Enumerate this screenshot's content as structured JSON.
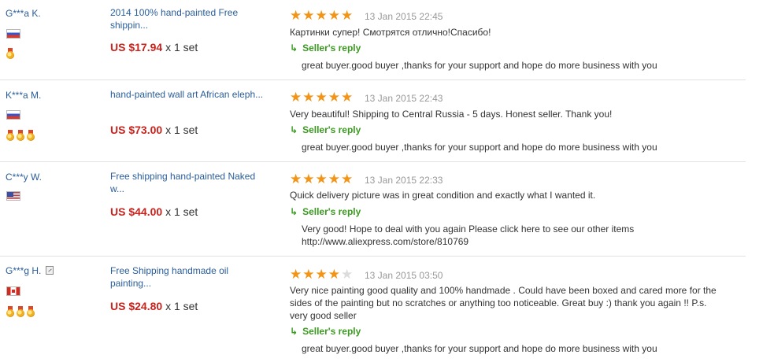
{
  "reviews": [
    {
      "buyer": "G***a K.",
      "flag": "russia-flag",
      "medals": 1,
      "mobile": false,
      "product": "2014 100% hand-painted Free shippin...",
      "price": "US $17.94",
      "qty": "x 1 set",
      "rating": 5,
      "date": "13 Jan 2015 22:45",
      "feedback": "Картинки супер! Смотрятся отлично!Спасибо!",
      "reply_label": "Seller's reply",
      "reply": "great buyer.good buyer ,thanks for your support and hope do more business with you"
    },
    {
      "buyer": "K***a M.",
      "flag": "russia-flag",
      "medals": 3,
      "mobile": false,
      "product": "hand-painted wall art African eleph...",
      "price": "US $73.00",
      "qty": "x 1 set",
      "rating": 5,
      "date": "13 Jan 2015 22:43",
      "feedback": "Very beautiful! Shipping to Central Russia - 5 days. Honest seller. Thank you!",
      "reply_label": "Seller's reply",
      "reply": "great buyer.good buyer ,thanks for your support and hope do more business with you"
    },
    {
      "buyer": "C***y W.",
      "flag": "usa-flag",
      "medals": 0,
      "mobile": false,
      "product": "Free shipping hand-painted Naked w...",
      "price": "US $44.00",
      "qty": "x 1 set",
      "rating": 5,
      "date": "13 Jan 2015 22:33",
      "feedback": "Quick delivery picture was in great condition and exactly what I wanted it.",
      "reply_label": "Seller's reply",
      "reply": "Very good! Hope to deal with you again Please click here to see our other items",
      "reply_url": "http://www.aliexpress.com/store/810769"
    },
    {
      "buyer": "G***g H.",
      "flag": "canada-flag",
      "medals": 3,
      "mobile": true,
      "product": "Free Shipping handmade oil painting...",
      "price": "US $24.80",
      "qty": "x 1 set",
      "rating": 4,
      "date": "13 Jan 2015 03:50",
      "feedback": "Very nice painting good quality and 100% handmade . Could have been boxed and cared more for the sides of the painting but no scratches or anything too noticeable. Great buy :) thank you again !! P.s. very good seller",
      "reply_label": "Seller's reply",
      "reply": "great buyer.good buyer ,thanks for your support and hope do more business with you"
    }
  ],
  "colors": {
    "link": "#2a5d99",
    "price": "#c8231d",
    "star": "#f39416",
    "reply": "#3a9b1f",
    "date": "#999999"
  }
}
